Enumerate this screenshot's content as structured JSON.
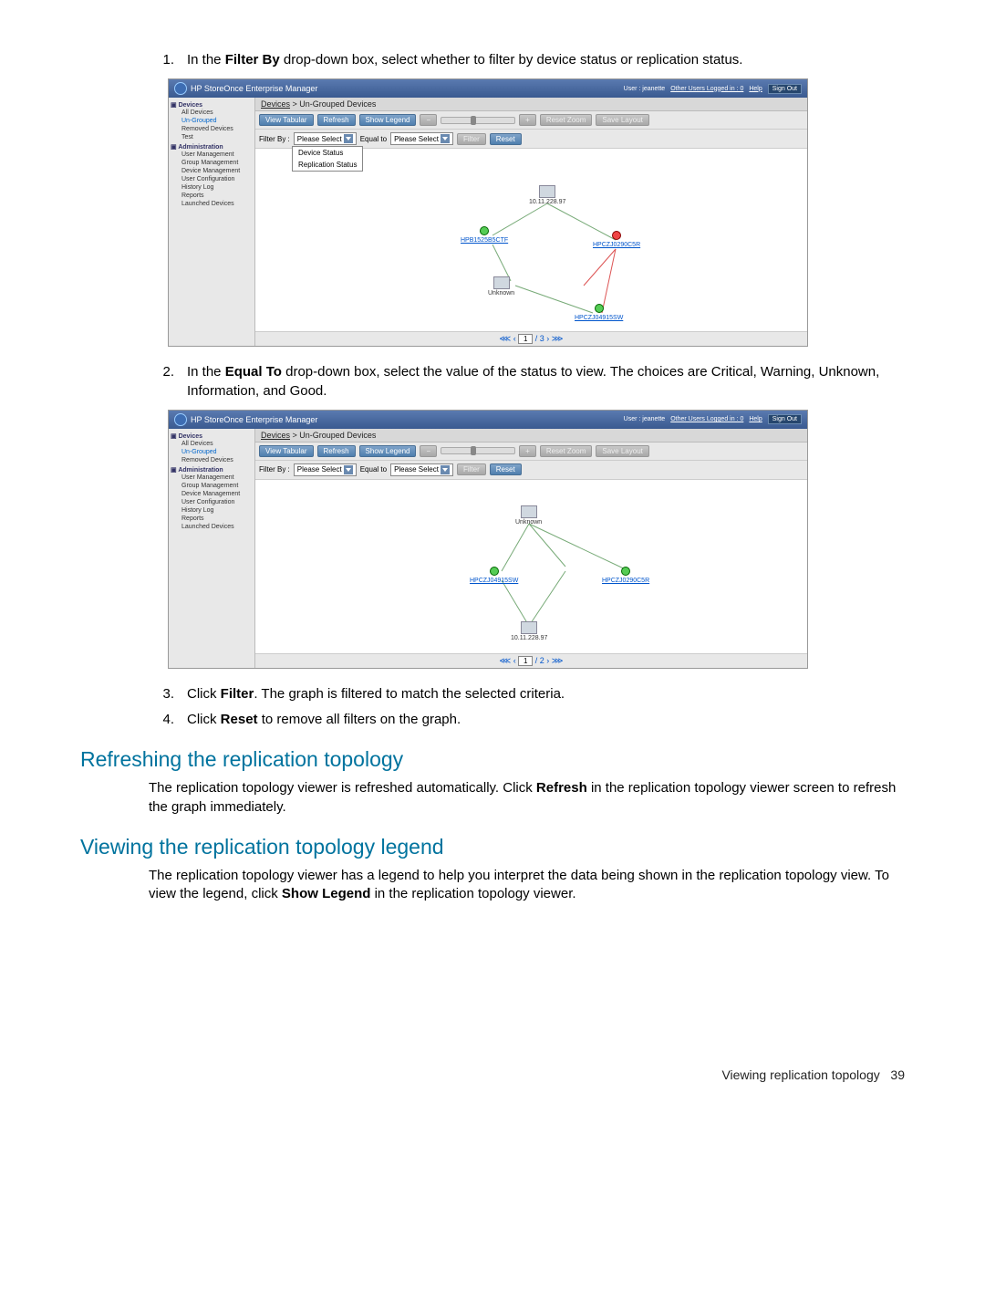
{
  "steps": {
    "s1_num": "1.",
    "s1_a": "In the ",
    "s1_b": "Filter By",
    "s1_c": " drop-down box, select whether to filter by device status or replication status.",
    "s2_num": "2.",
    "s2_a": "In the ",
    "s2_b": "Equal To",
    "s2_c": " drop-down box, select the value of the status to view. The choices are Critical, Warning, Unknown, Information, and Good.",
    "s3_num": "3.",
    "s3_a": "Click ",
    "s3_b": "Filter",
    "s3_c": ". The graph is filtered to match the selected criteria.",
    "s4_num": "4.",
    "s4_a": "Click ",
    "s4_b": "Reset",
    "s4_c": " to remove all filters on the graph."
  },
  "shot": {
    "title": "HP StoreOnce Enterprise Manager",
    "user_label": "User : jeanette",
    "other_users": "Other Users Logged in : 0",
    "help": "Help",
    "signout": "Sign Out",
    "breadcrumb_a": "Devices",
    "breadcrumb_sep": " > ",
    "breadcrumb_b": "Un-Grouped Devices",
    "btn_view": "View Tabular",
    "btn_refresh": "Refresh",
    "btn_legend": "Show Legend",
    "btn_resetzoom": "Reset Zoom",
    "btn_savelayout": "Save Layout",
    "filter_label": "Filter By :",
    "sel_please": "Please Select",
    "equal_label": "Equal to",
    "btn_filter": "Filter",
    "btn_reset": "Reset",
    "dd_opt1": "Device Status",
    "dd_opt2": "Replication Status",
    "pager_total": "/ 3",
    "pager_total2": "/ 2",
    "pager_cur": "1",
    "side": {
      "devices": "Devices",
      "all": "All Devices",
      "ungrouped": "Un-Grouped",
      "removed": "Removed Devices",
      "test": "Test",
      "admin": "Administration",
      "usermgmt": "User Management",
      "groupmgmt": "Group Management",
      "devmgmt": "Device Management",
      "usercfg": "User Configuration",
      "history": "History Log",
      "reports": "Reports",
      "launched": "Launched Devices"
    },
    "nodes1": {
      "a_ip": "10.11.228.97",
      "b": "HPB1525B5CTF",
      "c": "HPCZJ0290C5R",
      "d": "Unknown",
      "e": "HPCZJ04915SW"
    },
    "nodes2": {
      "a": "Unknown",
      "b": "HPCZJ04915SW",
      "c": "HPCZJ0290C5R",
      "d": "10.11.228.97"
    }
  },
  "sections": {
    "h1": "Refreshing the replication topology",
    "p1a": "The replication topology viewer is refreshed automatically. Click ",
    "p1b": "Refresh",
    "p1c": " in the replication topology viewer screen to refresh the graph immediately.",
    "h2": "Viewing the replication topology legend",
    "p2a": "The replication topology viewer has a legend to help you interpret the data being shown in the replication topology view. To view the legend, click ",
    "p2b": "Show Legend",
    "p2c": " in the replication topology viewer."
  },
  "footer": {
    "label": "Viewing replication topology",
    "page": "39"
  }
}
